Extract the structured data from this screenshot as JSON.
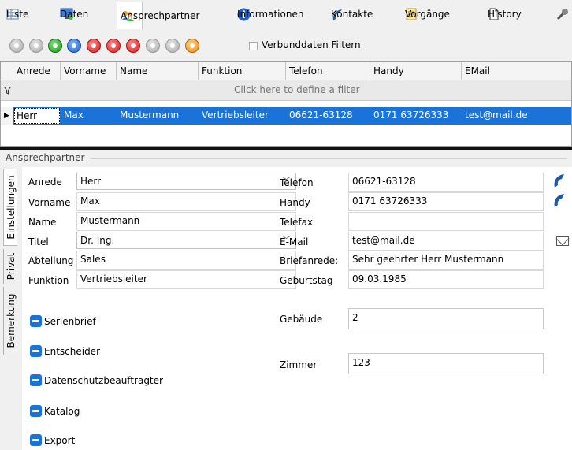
{
  "tabs": [
    {
      "label": "Liste",
      "icon": "list-icon",
      "active": false
    },
    {
      "label": "Daten",
      "icon": "monitor-icon",
      "active": false
    },
    {
      "label": "Ansprechpartner",
      "icon": "contacts-icon",
      "active": true
    },
    {
      "label": "Informationen",
      "icon": "info-icon",
      "active": false
    },
    {
      "label": "Kontakte",
      "icon": "phone-icon",
      "active": false
    },
    {
      "label": "Vorgänge",
      "icon": "notes-icon",
      "active": false
    },
    {
      "label": "History",
      "icon": "document-icon",
      "active": false
    }
  ],
  "toolbar": {
    "buttons": [
      "first-record-icon",
      "previous-record-icon",
      "next-record-icon",
      "last-record-icon",
      "insert-record-icon",
      "delete-record-icon",
      "edit-record-icon",
      "post-record-icon",
      "cancel-record-icon",
      "refresh-icon"
    ],
    "filter_label": "Verbunddaten Filtern",
    "filter_checked": false
  },
  "grid": {
    "columns": [
      "Anrede",
      "Vorname",
      "Name",
      "Funktion",
      "Telefon",
      "Handy",
      "EMail"
    ],
    "filter_hint": "Click here to define a filter",
    "rows": [
      [
        "Herr",
        "Max",
        "Mustermann",
        "Vertriebsleiter",
        "06621-63128",
        "0171 63726333",
        "test@mail.de"
      ]
    ]
  },
  "section": {
    "title": "Ansprechpartner",
    "side_tabs": [
      "Einstellungen",
      "Privat",
      "Bemerkung"
    ]
  },
  "form": {
    "left": {
      "anrede_label": "Anrede",
      "anrede_value": "Herr",
      "vorname_label": "Vorname",
      "vorname_value": "Max",
      "name_label": "Name",
      "name_value": "Mustermann",
      "titel_label": "Titel",
      "titel_value": "Dr. Ing.",
      "abteilung_label": "Abteilung",
      "abteilung_value": "Sales",
      "funktion_label": "Funktion",
      "funktion_value": "Vertriebsleiter"
    },
    "right": {
      "telefon_label": "Telefon",
      "telefon_value": "06621-63128",
      "handy_label": "Handy",
      "handy_value": "0171 63726333",
      "telefax_label": "Telefax",
      "telefax_value": "",
      "email_label": "E-Mail",
      "email_value": "test@mail.de",
      "briefanrede_label": "Briefanrede:",
      "briefanrede_value": "Sehr geehrter Herr Mustermann",
      "geburtstag_label": "Geburtstag",
      "geburtstag_value": "09.03.1985",
      "gebaeude_label": "Gebäude",
      "gebaeude_value": "2",
      "zimmer_label": "Zimmer",
      "zimmer_value": "123"
    },
    "groups": [
      "Serienbrief",
      "Entscheider",
      "Datenschutzbeauftragter",
      "Katalog",
      "Export"
    ]
  }
}
